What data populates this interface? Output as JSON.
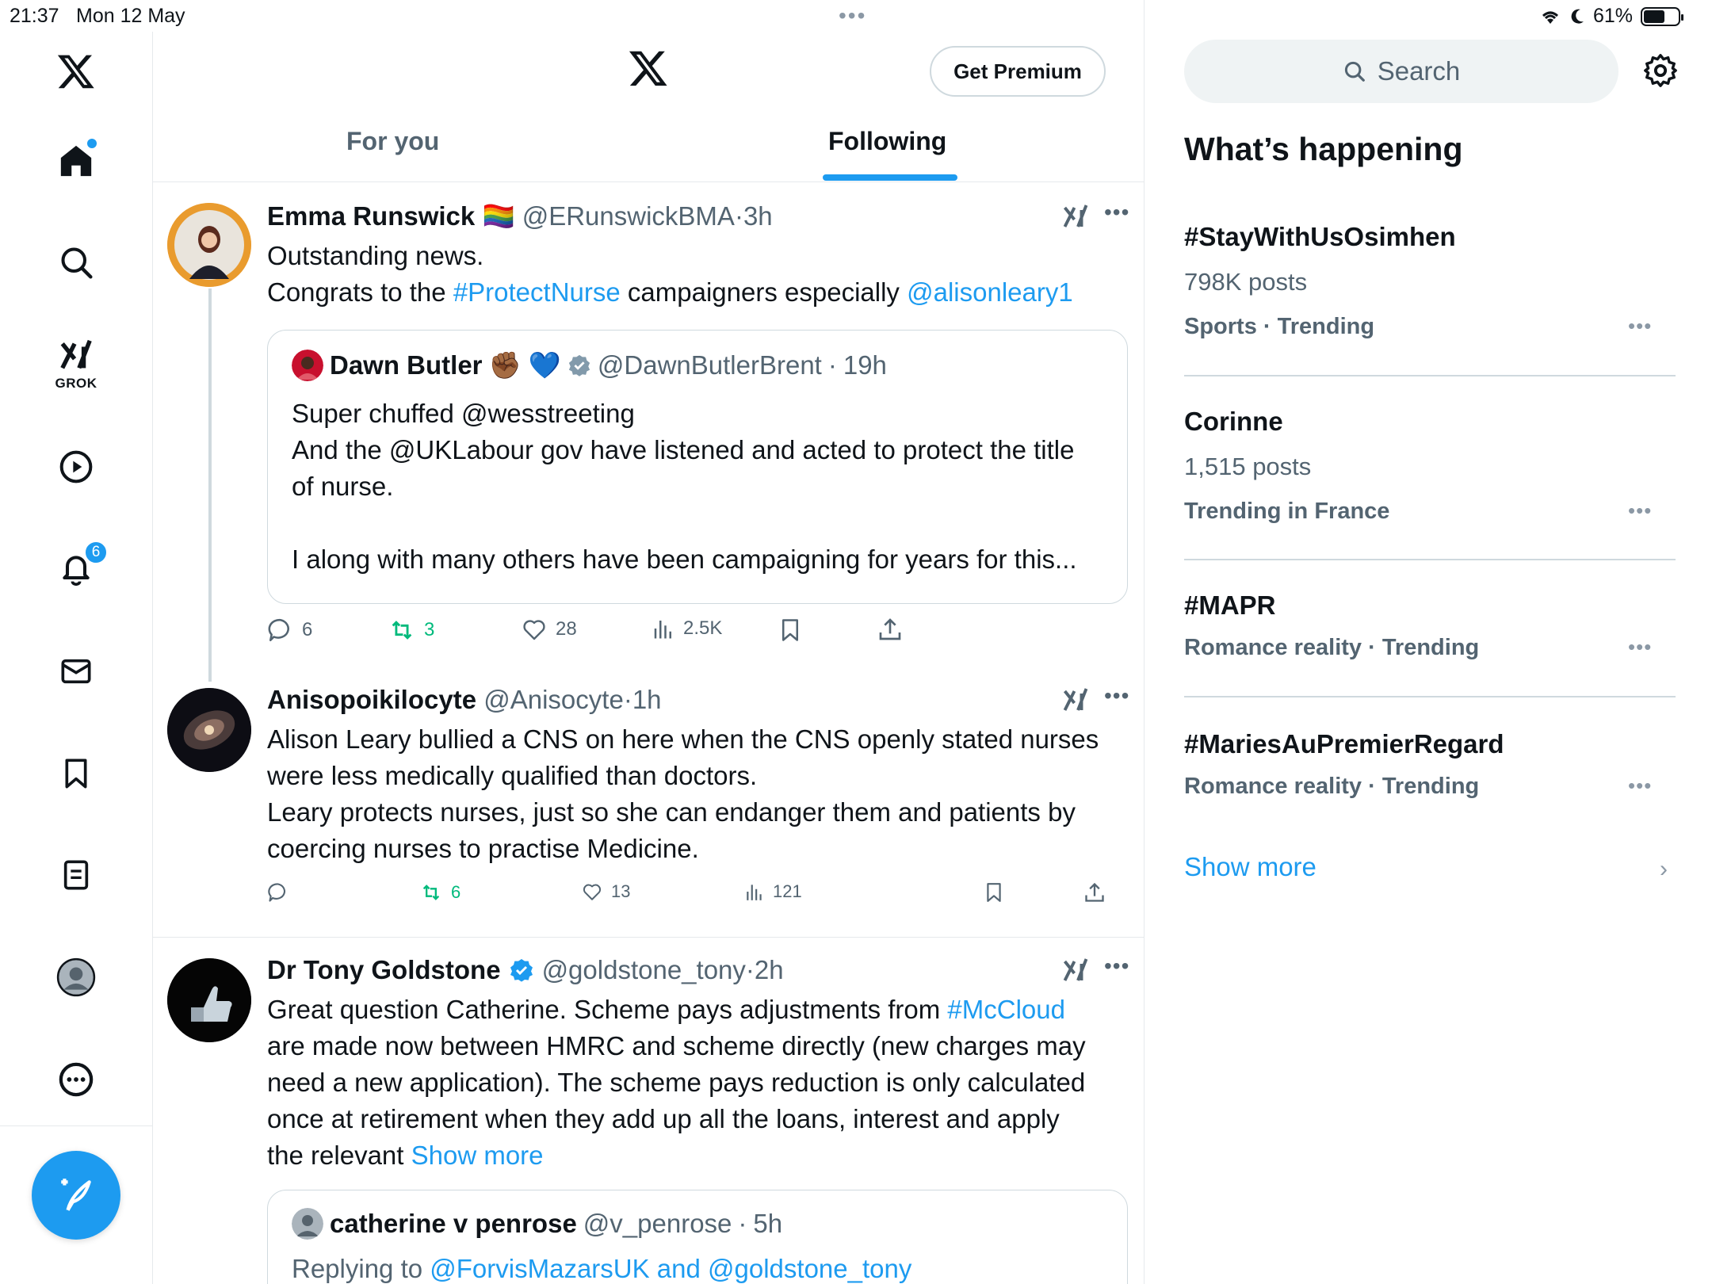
{
  "status_bar": {
    "time": "21:37",
    "date": "Mon 12 May",
    "battery": "61%",
    "battery_level": 0.61
  },
  "nav": {
    "grok_label": "GROK",
    "notifications_count": "6"
  },
  "header": {
    "premium_label": "Get Premium"
  },
  "tabs": [
    {
      "label": "For you"
    },
    {
      "label": "Following"
    }
  ],
  "posts": [
    {
      "name": "Emma Runswick",
      "flag": "🏳️‍🌈",
      "handle": "@ERunswickBMA",
      "time": "3h",
      "line1": "Outstanding news.",
      "line2_pre": "Congrats to the ",
      "line2_hashtag": "#ProtectNurse",
      "line2_mid": " campaigners especially ",
      "line2_mention": "@alisonleary1",
      "quote": {
        "name": "Dawn Butler",
        "emoji": "✊🏾 💙",
        "handle": "@DawnButlerBrent",
        "time": "19h",
        "lines": [
          "Super chuffed @wesstreeting",
          "And the @UKLabour gov have listened and acted to protect the title",
          "of nurse.",
          "",
          "I along with many others have been campaigning for years for this..."
        ]
      },
      "replies": "6",
      "reposts": "3",
      "likes": "28",
      "views": "2.5K"
    },
    {
      "name": "Anisopoikilocyte",
      "handle": "@Anisocyte",
      "time": "1h",
      "lines": [
        "Alison Leary bullied a CNS on here when the CNS openly stated nurses",
        "were less medically qualified than doctors.",
        "Leary protects nurses, just so she can endanger them and patients by",
        "coercing nurses to practise Medicine."
      ],
      "replies": "",
      "reposts": "6",
      "likes": "13",
      "views": "121"
    },
    {
      "name": "Dr Tony Goldstone",
      "handle": "@goldstone_tony",
      "time": "2h",
      "line1_pre": "Great question Catherine. Scheme pays adjustments from ",
      "line1_hashtag": "#McCloud",
      "lines": [
        "are made now between HMRC and scheme directly (new charges may",
        "need a new application). The scheme pays reduction is only calculated",
        "once at retirement when they add up all the loans, interest and apply"
      ],
      "last_pre": "the relevant ",
      "show_more": "Show more",
      "quote": {
        "name": "catherine v penrose",
        "handle": "@v_penrose",
        "time": "5h",
        "reply_pre": "Replying to ",
        "reply_mentions": "@ForvisMazarsUK and @goldstone_tony"
      }
    }
  ],
  "sidebar": {
    "search_placeholder": "Search",
    "title": "What’s happening",
    "trends": [
      {
        "name": "#StayWithUsOsimhen",
        "count": "798K posts",
        "meta": "Sports · Trending"
      },
      {
        "name": "Corinne",
        "count": "1,515 posts",
        "meta": "Trending in France"
      },
      {
        "name": "#MAPR",
        "count": "",
        "meta": "Romance reality · Trending"
      },
      {
        "name": "#MariesAuPremierRegard",
        "count": "",
        "meta": "Romance reality · Trending"
      }
    ],
    "show_more": "Show more"
  },
  "colors": {
    "accent": "#1d9bf0",
    "repost": "#00ba7c",
    "muted": "#536471"
  }
}
